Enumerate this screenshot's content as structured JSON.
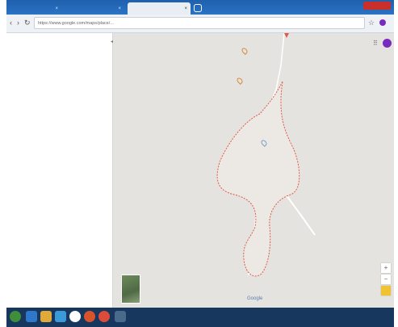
{
  "browser": {
    "tabs": [
      {
        "label": "",
        "close": "×"
      },
      {
        "label": "",
        "close": "×"
      },
      {
        "label": "",
        "close": "×"
      }
    ],
    "address": "https://www.google.com/maps/place/...",
    "back": "‹",
    "forward": "›",
    "reload": "↻",
    "star": "☆"
  },
  "map": {
    "poi_top": "",
    "poi_second": "",
    "center_label": "",
    "apps_icon": "⠿",
    "zoom_in": "+",
    "zoom_out": "−",
    "satellite_label": "",
    "google_logo": "Google",
    "attribution": "",
    "collapse": "◂"
  },
  "taskbar": {
    "tray_text": "",
    "clock_time": "",
    "clock_date": ""
  },
  "colors": {
    "boundary": "#e05a4a",
    "poi": "#c8743a",
    "avatar": "#7a2bbf",
    "titlebar": "#1f5fae"
  }
}
